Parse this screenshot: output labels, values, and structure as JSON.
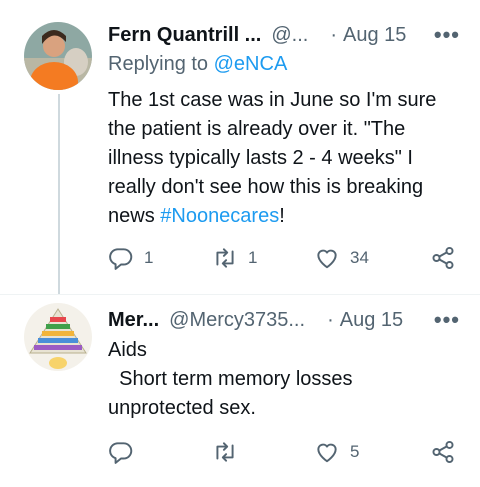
{
  "tweets": [
    {
      "author_name": "Fern Quantrill ...",
      "handle": "@...",
      "separator": "·",
      "date": "Aug 15",
      "more": "•••",
      "replying_prefix": "Replying to",
      "replying_to": "@eNCA",
      "lines": [
        "The 1st case was in June so I'm sure",
        "the patient is already over it. \"The",
        "illness typically lasts 2 - 4 weeks\" I",
        "really don't see how this is breaking"
      ],
      "last_line_prefix": "news ",
      "hashtag": "#Noonecares",
      "last_line_suffix": "!",
      "reply_count": "1",
      "retweet_count": "1",
      "like_count": "34"
    },
    {
      "author_name": "Mer...",
      "handle": "@Mercy3735...",
      "separator": "·",
      "date": "Aug 15",
      "more": "•••",
      "lines": [
        "Aids",
        "  Short term memory losses",
        "unprotected sex."
      ],
      "like_count": "5"
    }
  ],
  "colors": {
    "accent": "#1d9bf0",
    "muted": "#536471",
    "text": "#0f1419",
    "thread_line": "#cfd9de"
  },
  "icons": [
    "reply-icon",
    "retweet-icon",
    "like-icon",
    "share-icon",
    "more-icon"
  ]
}
